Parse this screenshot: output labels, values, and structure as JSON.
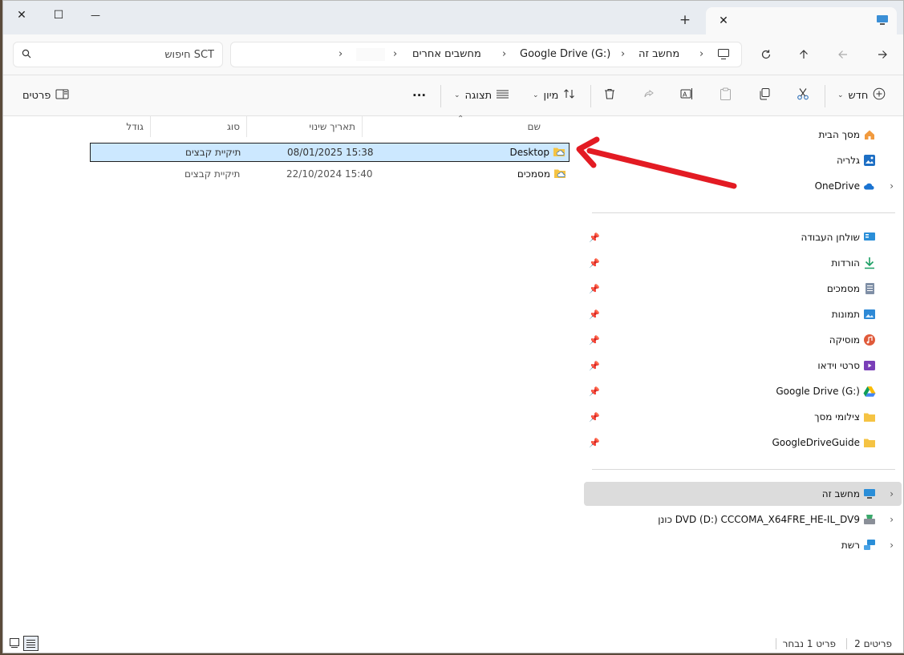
{
  "window": {
    "tab_title": "",
    "minimize_glyph": "—",
    "maximize_glyph": "☐",
    "close_glyph": "✕",
    "new_tab_glyph": "+"
  },
  "nav": {
    "search_placeholder": "חיפוש SCT",
    "breadcrumbs": [
      "מחשב זה",
      "Google Drive (G:)",
      "מחשבים אחרים",
      ""
    ]
  },
  "toolbar": {
    "new_label": "חדש",
    "sort_label": "מיון",
    "view_label": "תצוגה",
    "more_label": "···",
    "details_label": "פרטים"
  },
  "columns": {
    "name": "שם",
    "date": "תאריך שינוי",
    "type": "סוג",
    "size": "גודל"
  },
  "files": [
    {
      "name": "Desktop",
      "date": "08/01/2025 15:38",
      "type": "תיקיית קבצים",
      "size": ""
    },
    {
      "name": "מסמכים",
      "date": "22/10/2024 15:40",
      "type": "תיקיית קבצים",
      "size": ""
    }
  ],
  "sidebar": {
    "top": [
      {
        "label": "מסך הבית",
        "icon": "home-icon"
      },
      {
        "label": "גלריה",
        "icon": "gallery-icon"
      },
      {
        "label": "OneDrive",
        "icon": "onedrive-cloud-icon"
      }
    ],
    "quick": [
      {
        "label": "שולחן העבודה",
        "icon": "desktop-icon"
      },
      {
        "label": "הורדות",
        "icon": "download-icon"
      },
      {
        "label": "מסמכים",
        "icon": "document-icon"
      },
      {
        "label": "תמונות",
        "icon": "pictures-icon"
      },
      {
        "label": "מוסיקה",
        "icon": "music-icon"
      },
      {
        "label": "סרטי וידאו",
        "icon": "video-icon"
      },
      {
        "label": "Google Drive (G:)",
        "icon": "google-drive-icon"
      },
      {
        "label": "צילומי מסך",
        "icon": "folder-icon"
      },
      {
        "label": "GoogleDriveGuide",
        "icon": "folder-icon"
      }
    ],
    "bottom": [
      {
        "label": "מחשב זה",
        "icon": "this-pc-icon"
      },
      {
        "label": "כונן DVD (D:) CCCOMA_X64FRE_HE-IL_DV9",
        "icon": "dvd-drive-icon"
      },
      {
        "label": "רשת",
        "icon": "network-icon"
      }
    ]
  },
  "status": {
    "count": "2 פריטים",
    "selected": "פריט 1 נבחר"
  },
  "colors": {
    "selection": "#cce8ff",
    "arrow": "#e31b23",
    "folder": "#f5c343"
  }
}
